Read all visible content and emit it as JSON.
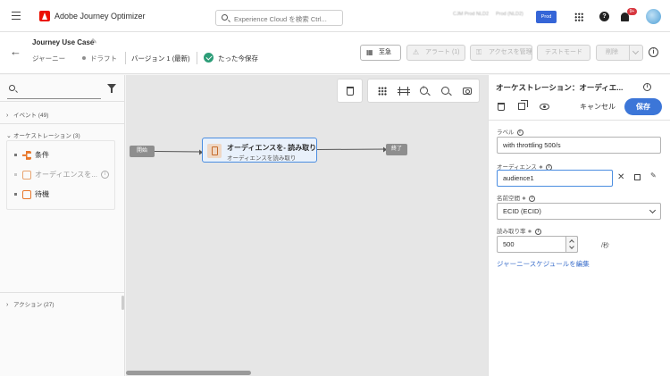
{
  "app": {
    "title": "Adobe Journey Optimizer",
    "search_placeholder": "Experience Cloud を検索 Ctrl...",
    "org_primary": "CJM Prod NLD2",
    "org_secondary": "Prod (NLD2)",
    "env_badge": "Prod",
    "notification_count": "9+"
  },
  "journey": {
    "title": "Journey Use Case",
    "type": "ジャーニー",
    "status": "ドラフト",
    "version": "バージョン 1 (最新)",
    "saved": "たった今保存"
  },
  "header_buttons": {
    "urgent": "至急",
    "alert": "アラート (1)",
    "access": "アクセスを管理",
    "test": "テストモード",
    "delete": "削除"
  },
  "palette": {
    "sections": {
      "events": "イベント (49)",
      "orchestration": "オーケストレーション (3)",
      "actions": "アクション (27)"
    },
    "orchestration_items": [
      "条件",
      "オーディエンスを...",
      "待機"
    ]
  },
  "canvas": {
    "start_label": "開始",
    "end_label": "終了",
    "node_title": "オーディエンスを- 読み取り",
    "node_subtitle": "オーディエンスを読み取り"
  },
  "properties": {
    "title": "オーケストレーション：オーディエ...",
    "cancel": "キャンセル",
    "save": "保存",
    "label_field": {
      "label": "ラベル",
      "value": "with throttling 500/s"
    },
    "audience_field": {
      "label": "オーディエンス",
      "value": "audience1"
    },
    "namespace_field": {
      "label": "名前空間",
      "value": "ECID (ECID)"
    },
    "rate_field": {
      "label": "読み取り率",
      "value": "500",
      "unit": "/秒"
    },
    "schedule_link": "ジャーニースケジュールを編集"
  },
  "colors": {
    "accent": "#3c76d8",
    "brand_red": "#eb1000",
    "success": "#2d9d78",
    "node_highlight": "#4b8de0",
    "orchestration_orange": "#e8772a"
  }
}
